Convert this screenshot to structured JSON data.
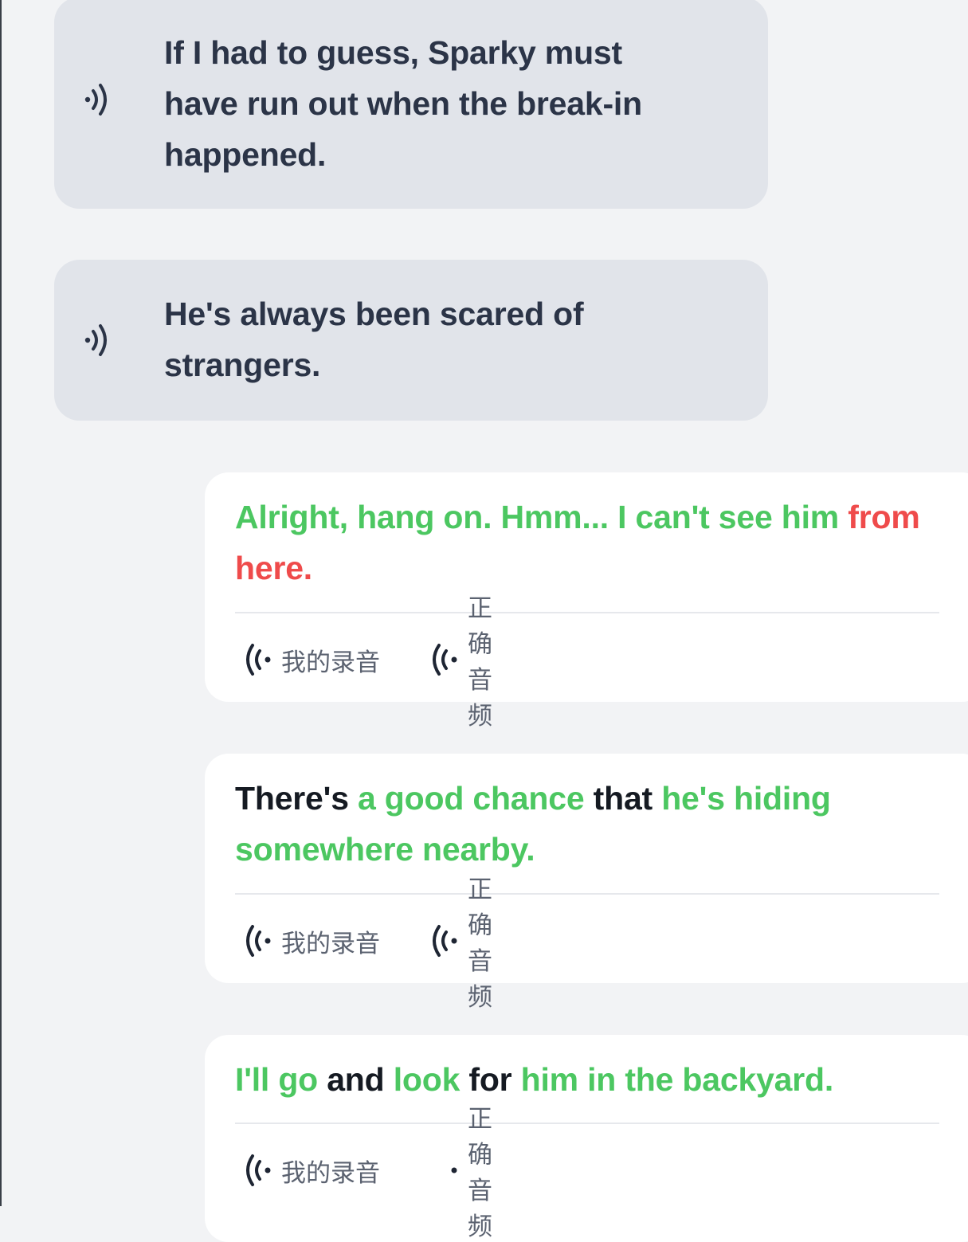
{
  "colors": {
    "background": "#f2f3f5",
    "bubble": "#e1e4ea",
    "bubble_text": "#2b3447",
    "card": "#ffffff",
    "correct": "#4cc761",
    "incorrect": "#ef4b4b",
    "neutral": "#151a22",
    "action_text": "#5b6270"
  },
  "bubbles": [
    {
      "text": "If I had to guess, Sparky must have run out when the break-in happened.",
      "icon": "speaker-icon"
    },
    {
      "text": "He's always been scared of strangers.",
      "icon": "speaker-icon"
    }
  ],
  "cards": [
    {
      "segments": [
        {
          "text": "Alright, hang on. Hmm... I can't see him ",
          "status": "green"
        },
        {
          "text": "from here.",
          "status": "red"
        }
      ],
      "my_recording_label": "我的录音",
      "correct_audio_label": "正确音频",
      "correct_audio_playing": false
    },
    {
      "segments": [
        {
          "text": "There's ",
          "status": "black"
        },
        {
          "text": "a good chance ",
          "status": "green"
        },
        {
          "text": "that ",
          "status": "black"
        },
        {
          "text": "he's hiding somewhere nearby.",
          "status": "green"
        }
      ],
      "my_recording_label": "我的录音",
      "correct_audio_label": "正确音频",
      "correct_audio_playing": false
    },
    {
      "segments": [
        {
          "text": "I'll go ",
          "status": "green"
        },
        {
          "text": "and ",
          "status": "black"
        },
        {
          "text": "look ",
          "status": "green"
        },
        {
          "text": "for ",
          "status": "black"
        },
        {
          "text": "him in the backyard.",
          "status": "green"
        }
      ],
      "my_recording_label": "我的录音",
      "correct_audio_label": "正确音频",
      "correct_audio_playing": true
    }
  ]
}
